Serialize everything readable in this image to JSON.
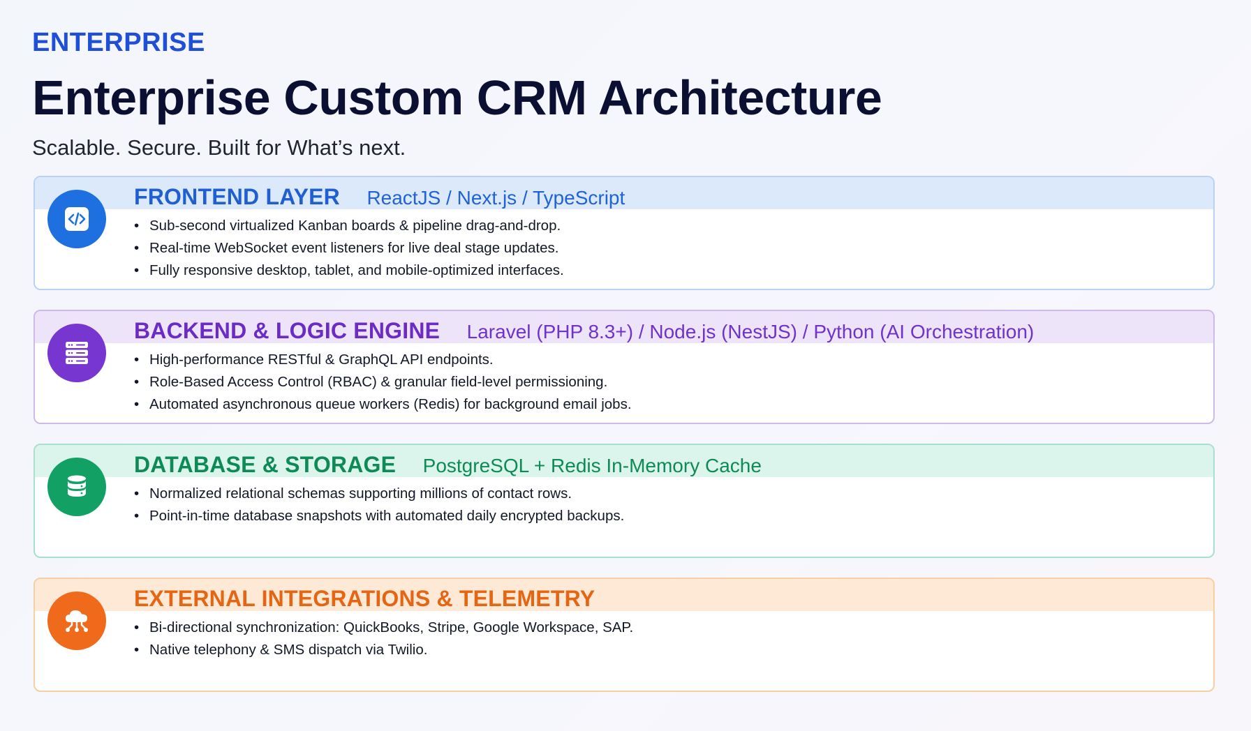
{
  "header": {
    "eyebrow": "ENTERPRISE",
    "title": "Enterprise Custom CRM Architecture",
    "subtitle": "Scalable. Secure. Built for What’s next."
  },
  "layers": [
    {
      "heading": "FRONTEND LAYER",
      "tech": "ReactJS / Next.js / TypeScript",
      "icon": "code-icon",
      "accent": "#1e6fe0",
      "bullets": [
        "Sub-second virtualized Kanban boards & pipeline drag-and-drop.",
        "Real-time WebSocket event listeners for live deal stage updates.",
        "Fully responsive desktop, tablet, and mobile-optimized interfaces."
      ]
    },
    {
      "heading": "BACKEND & LOGIC ENGINE",
      "tech": "Laravel (PHP 8.3+) / Node.js (NestJS) / Python (AI Orchestration)",
      "icon": "server-icon",
      "accent": "#7636cf",
      "bullets": [
        "High-performance RESTful & GraphQL API endpoints.",
        "Role-Based Access Control (RBAC) & granular field-level permissioning.",
        "Automated asynchronous queue workers (Redis) for background email jobs."
      ]
    },
    {
      "heading": "DATABASE & STORAGE",
      "tech": "PostgreSQL + Redis In-Memory Cache",
      "icon": "database-icon",
      "accent": "#12a065",
      "bullets": [
        "Normalized relational schemas supporting millions of contact rows.",
        "Point-in-time database snapshots with automated daily encrypted backups."
      ]
    },
    {
      "heading": "EXTERNAL INTEGRATIONS & TELEMETRY",
      "tech": "",
      "icon": "cloud-network-icon",
      "accent": "#f06a1c",
      "bullets": [
        "Bi-directional synchronization: QuickBooks, Stripe, Google Workspace, SAP.",
        "Native telephony & SMS dispatch via Twilio."
      ]
    }
  ]
}
